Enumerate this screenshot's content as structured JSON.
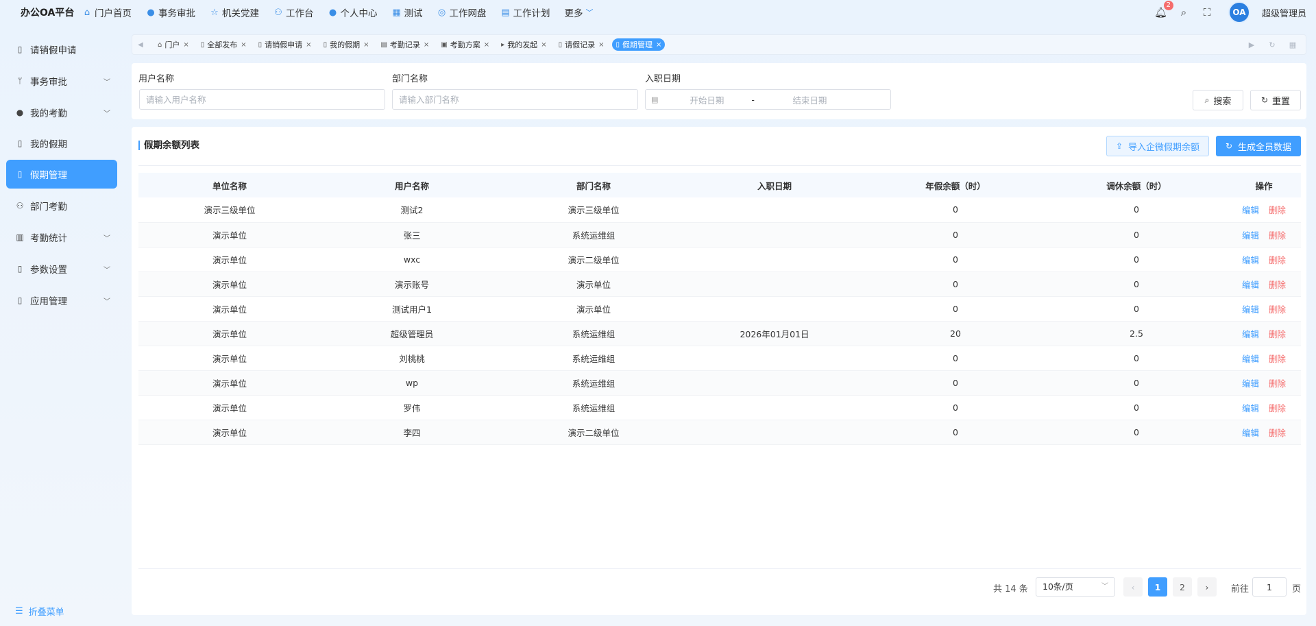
{
  "app": {
    "title": "办公OA平台"
  },
  "topnav": {
    "items": [
      {
        "label": "门户首页",
        "icon": "home-icon"
      },
      {
        "label": "事务审批",
        "icon": "info-icon"
      },
      {
        "label": "机关党建",
        "icon": "star-icon"
      },
      {
        "label": "工作台",
        "icon": "sitemap-icon"
      },
      {
        "label": "个人中心",
        "icon": "user-icon"
      },
      {
        "label": "测试",
        "icon": "grid-icon"
      },
      {
        "label": "工作网盘",
        "icon": "database-icon"
      },
      {
        "label": "工作计划",
        "icon": "calendar-icon"
      }
    ],
    "more_label": "更多",
    "notification_count": "2",
    "avatar_text": "OA",
    "username": "超级管理员"
  },
  "sidebar": {
    "items": [
      {
        "label": "请销假申请",
        "icon": "document-icon",
        "expandable": false
      },
      {
        "label": "事务审批",
        "icon": "branch-icon",
        "expandable": true
      },
      {
        "label": "我的考勤",
        "icon": "user-icon",
        "expandable": true
      },
      {
        "label": "我的假期",
        "icon": "document-icon",
        "expandable": false
      },
      {
        "label": "假期管理",
        "icon": "document-icon",
        "expandable": false,
        "active": true
      },
      {
        "label": "部门考勤",
        "icon": "org-icon",
        "expandable": false
      },
      {
        "label": "考勤统计",
        "icon": "bar-chart-icon",
        "expandable": true
      },
      {
        "label": "参数设置",
        "icon": "document-icon",
        "expandable": true
      },
      {
        "label": "应用管理",
        "icon": "document-icon",
        "expandable": true
      }
    ],
    "collapse_label": "折叠菜单"
  },
  "tabs": [
    {
      "label": "门户",
      "icon": "home-icon"
    },
    {
      "label": "全部发布",
      "icon": "document-icon"
    },
    {
      "label": "请销假申请",
      "icon": "document-icon"
    },
    {
      "label": "我的假期",
      "icon": "document-icon"
    },
    {
      "label": "考勤记录",
      "icon": "calendar-icon"
    },
    {
      "label": "考勤方案",
      "icon": "calendar-check-icon"
    },
    {
      "label": "我的发起",
      "icon": "caret-icon"
    },
    {
      "label": "请假记录",
      "icon": "document-icon"
    },
    {
      "label": "假期管理",
      "icon": "document-icon",
      "active": true
    }
  ],
  "search": {
    "user_label": "用户名称",
    "user_placeholder": "请输入用户名称",
    "dept_label": "部门名称",
    "dept_placeholder": "请输入部门名称",
    "date_label": "入职日期",
    "date_start_placeholder": "开始日期",
    "date_separator": "-",
    "date_end_placeholder": "结束日期",
    "search_button": "搜索",
    "reset_button": "重置"
  },
  "list": {
    "title": "假期余额列表",
    "import_button": "导入企微假期余额",
    "generate_button": "生成全员数据",
    "columns": [
      "单位名称",
      "用户名称",
      "部门名称",
      "入职日期",
      "年假余额（时）",
      "调休余额（时）",
      "操作"
    ],
    "edit_label": "编辑",
    "delete_label": "删除",
    "rows": [
      [
        "演示三级单位",
        "测试2",
        "演示三级单位",
        "",
        "0",
        "0"
      ],
      [
        "演示单位",
        "张三",
        "系统运维组",
        "",
        "0",
        "0"
      ],
      [
        "演示单位",
        "wxc",
        "演示二级单位",
        "",
        "0",
        "0"
      ],
      [
        "演示单位",
        "演示账号",
        "演示单位",
        "",
        "0",
        "0"
      ],
      [
        "演示单位",
        "测试用户1",
        "演示单位",
        "",
        "0",
        "0"
      ],
      [
        "演示单位",
        "超级管理员",
        "系统运维组",
        "2026年01月01日",
        "20",
        "2.5"
      ],
      [
        "演示单位",
        "刘桃桃",
        "系统运维组",
        "",
        "0",
        "0"
      ],
      [
        "演示单位",
        "wp",
        "系统运维组",
        "",
        "0",
        "0"
      ],
      [
        "演示单位",
        "罗伟",
        "系统运维组",
        "",
        "0",
        "0"
      ],
      [
        "演示单位",
        "李四",
        "演示二级单位",
        "",
        "0",
        "0"
      ]
    ]
  },
  "pagination": {
    "total_text": "共 14 条",
    "page_size": "10条/页",
    "pages": [
      "1",
      "2"
    ],
    "current_page": "1",
    "goto_label": "前往",
    "goto_value": "1",
    "page_suffix": "页"
  },
  "colors": {
    "accent": "#409eff",
    "danger": "#f56c6c"
  }
}
